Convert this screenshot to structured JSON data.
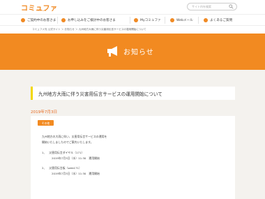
{
  "header": {
    "logo": "コミュファ",
    "logo_sub": "commufa",
    "search_placeholder": "サイト内を検索"
  },
  "nav": {
    "items": [
      {
        "label": "ご契約中のお客さま"
      },
      {
        "label": "お申し込みをご検討中のお客さま"
      },
      {
        "label": "Myコミュファ"
      },
      {
        "label": "Webメール"
      },
      {
        "label": "よくあるご質問"
      }
    ]
  },
  "breadcrumb": "コミュファ光 公式サイト ＞ お知らせ ＞ 九州地方大雨に伴う災害用伝言サービスの運用開始について",
  "banner": {
    "title": "お知らせ",
    "accent": "#f28a21"
  },
  "article": {
    "title": "九州地方大雨に伴う災害用伝言サービスの運用開始について",
    "date": "2019年7月3日",
    "badge": "その他",
    "intro1": "九州地方の大雨に伴い、災害用伝言サービスの運用を",
    "intro2": "開始いたしましたのでご案内いたします。",
    "item1": "1、　災害用伝言ダイヤル（171）",
    "item1_detail": "2019年7月3日（水）11:30　運用開始",
    "item2": "2、　災害用伝言板（web171）",
    "item2_detail": "2019年7月3日（水）11:30　運用開始"
  }
}
